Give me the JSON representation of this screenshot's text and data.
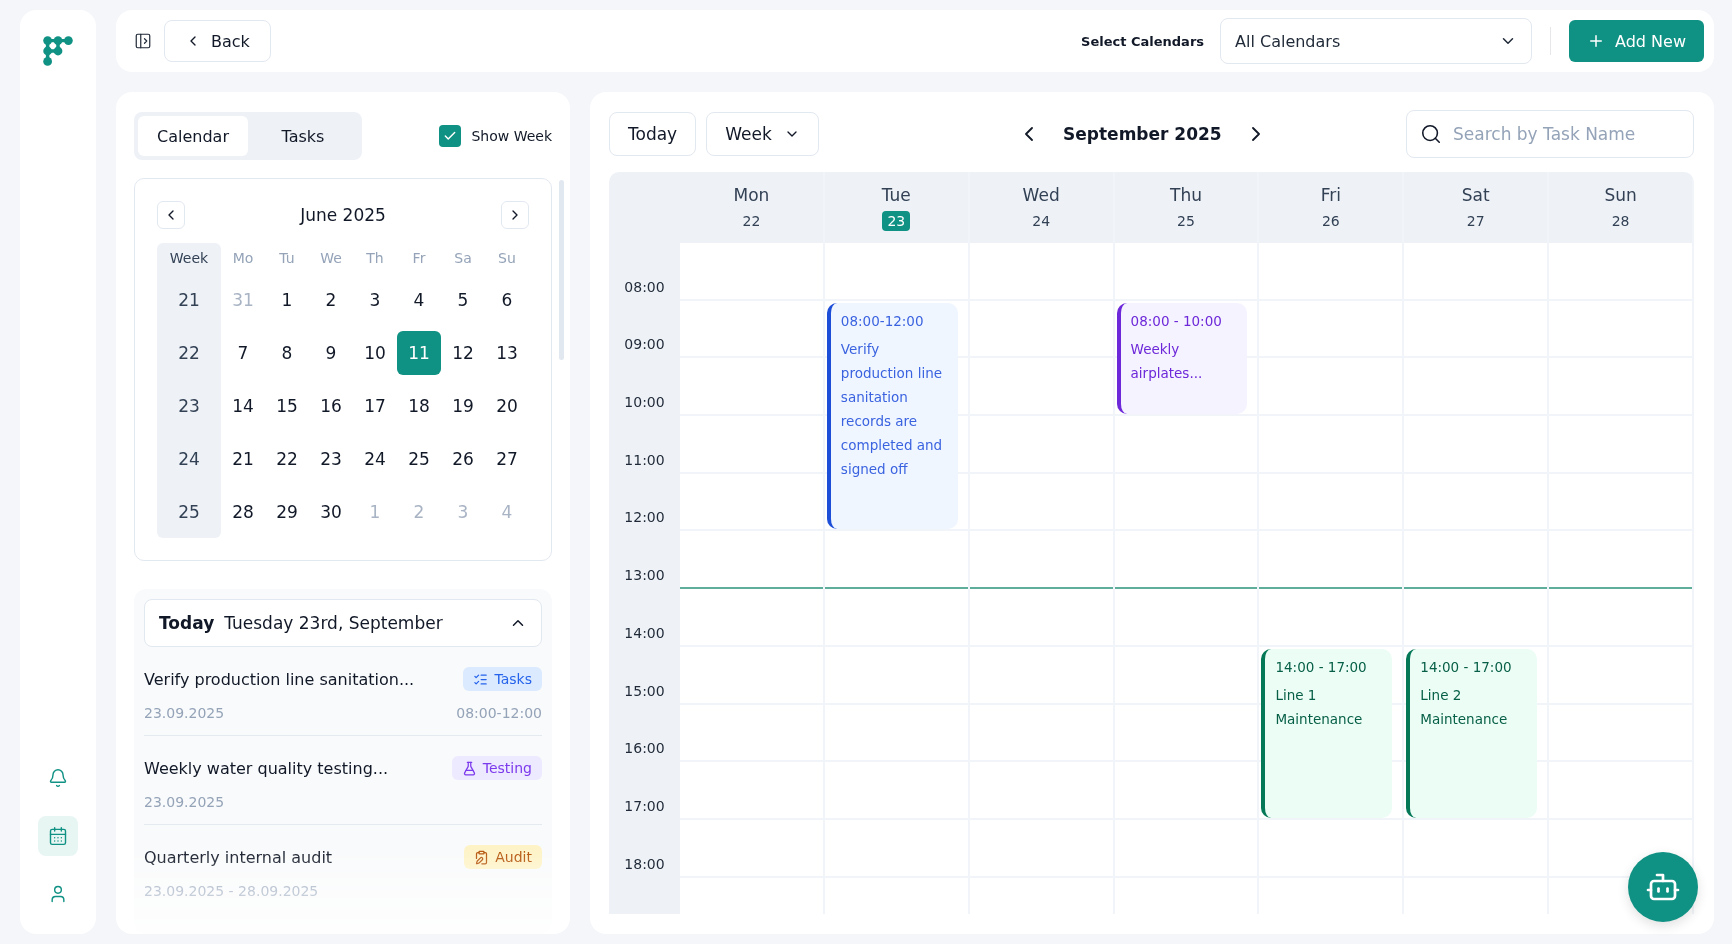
{
  "sidebar": {
    "nav": [
      {
        "kind": "bell",
        "selected": false
      },
      {
        "kind": "calendar",
        "selected": true
      },
      {
        "kind": "user",
        "selected": false
      }
    ]
  },
  "topbar": {
    "back": "Back",
    "select_label": "Select Calendars",
    "calendar_select": "All Calendars",
    "add_button": "Add New"
  },
  "left_panel": {
    "tabs": [
      {
        "label": "Calendar",
        "selected": true
      },
      {
        "label": "Tasks",
        "selected": false
      }
    ],
    "show_week": {
      "label": "Show Week",
      "checked": true
    },
    "mini_calendar": {
      "month": "June 2025",
      "week_header": "Week",
      "weekdays": [
        "Mo",
        "Tu",
        "We",
        "Th",
        "Fr",
        "Sa",
        "Su"
      ],
      "weeks": [
        {
          "week": "21",
          "days": [
            {
              "label": "31",
              "outside": true,
              "selected": false
            },
            {
              "label": "1",
              "outside": false,
              "selected": false
            },
            {
              "label": "2",
              "outside": false,
              "selected": false
            },
            {
              "label": "3",
              "outside": false,
              "selected": false
            },
            {
              "label": "4",
              "outside": false,
              "selected": false
            },
            {
              "label": "5",
              "outside": false,
              "selected": false
            },
            {
              "label": "6",
              "outside": false,
              "selected": false
            }
          ]
        },
        {
          "week": "22",
          "days": [
            {
              "label": "7",
              "outside": false,
              "selected": false
            },
            {
              "label": "8",
              "outside": false,
              "selected": false
            },
            {
              "label": "9",
              "outside": false,
              "selected": false
            },
            {
              "label": "10",
              "outside": false,
              "selected": false
            },
            {
              "label": "11",
              "outside": false,
              "selected": true
            },
            {
              "label": "12",
              "outside": false,
              "selected": false
            },
            {
              "label": "13",
              "outside": false,
              "selected": false
            }
          ]
        },
        {
          "week": "23",
          "days": [
            {
              "label": "14",
              "outside": false,
              "selected": false
            },
            {
              "label": "15",
              "outside": false,
              "selected": false
            },
            {
              "label": "16",
              "outside": false,
              "selected": false
            },
            {
              "label": "17",
              "outside": false,
              "selected": false
            },
            {
              "label": "18",
              "outside": false,
              "selected": false
            },
            {
              "label": "19",
              "outside": false,
              "selected": false
            },
            {
              "label": "20",
              "outside": false,
              "selected": false
            }
          ]
        },
        {
          "week": "24",
          "days": [
            {
              "label": "21",
              "outside": false,
              "selected": false
            },
            {
              "label": "22",
              "outside": false,
              "selected": false
            },
            {
              "label": "23",
              "outside": false,
              "selected": false
            },
            {
              "label": "24",
              "outside": false,
              "selected": false
            },
            {
              "label": "25",
              "outside": false,
              "selected": false
            },
            {
              "label": "26",
              "outside": false,
              "selected": false
            },
            {
              "label": "27",
              "outside": false,
              "selected": false
            }
          ]
        },
        {
          "week": "25",
          "days": [
            {
              "label": "28",
              "outside": false,
              "selected": false
            },
            {
              "label": "29",
              "outside": false,
              "selected": false
            },
            {
              "label": "30",
              "outside": false,
              "selected": false
            },
            {
              "label": "1",
              "outside": true,
              "selected": false
            },
            {
              "label": "2",
              "outside": true,
              "selected": false
            },
            {
              "label": "3",
              "outside": true,
              "selected": false
            },
            {
              "label": "4",
              "outside": true,
              "selected": false
            }
          ]
        }
      ]
    },
    "today": {
      "label": "Today",
      "date": "Tuesday 23rd, September",
      "expanded": true
    },
    "tasks": [
      {
        "title": "Verify production line sanitation...",
        "tag": {
          "label": "Tasks",
          "kind": "tasks"
        },
        "date": "23.09.2025",
        "time": "08:00-12:00"
      },
      {
        "title": "Weekly water quality testing...",
        "tag": {
          "label": "Testing",
          "kind": "testing"
        },
        "date": "23.09.2025"
      },
      {
        "title": "Quarterly internal audit",
        "tag": {
          "label": "Audit",
          "kind": "audit"
        },
        "date": "23.09.2025 - 28.09.2025"
      }
    ]
  },
  "calendar": {
    "today_button": "Today",
    "view": "Week",
    "month": "September 2025",
    "search": {
      "placeholder": "Search by Task Name"
    },
    "hours": [
      "08:00",
      "09:00",
      "10:00",
      "11:00",
      "12:00",
      "13:00",
      "14:00",
      "15:00",
      "16:00",
      "17:00",
      "18:00"
    ],
    "days": [
      {
        "name": "Mon",
        "date": "22",
        "selected": false
      },
      {
        "name": "Tue",
        "date": "23",
        "selected": true,
        "events": [
          {
            "kind": "tasks",
            "time": "08:00-12:00",
            "title": "Verify production line sanitation records are completed and signed off"
          }
        ]
      },
      {
        "name": "Wed",
        "date": "24",
        "selected": false
      },
      {
        "name": "Thu",
        "date": "25",
        "selected": false,
        "events": [
          {
            "kind": "testing",
            "time": "08:00 - 10:00",
            "title": "Weekly airplates..."
          }
        ]
      },
      {
        "name": "Fri",
        "date": "26",
        "selected": false,
        "events": [
          {
            "kind": "maintenance",
            "time": "14:00 - 17:00",
            "title": "Line 1 Maintenance"
          }
        ]
      },
      {
        "name": "Sat",
        "date": "27",
        "selected": false,
        "events": [
          {
            "kind": "maintenance",
            "time": "14:00 - 17:00",
            "title": "Line 2 Maintenance"
          }
        ]
      },
      {
        "name": "Sun",
        "date": "28",
        "selected": false
      }
    ]
  }
}
